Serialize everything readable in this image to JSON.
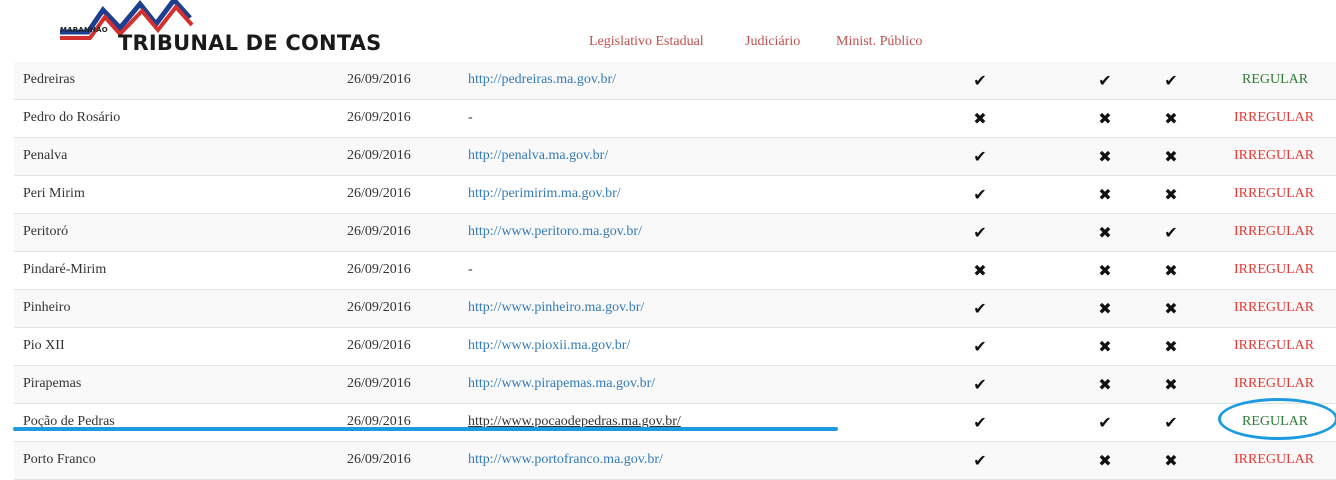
{
  "header": {
    "logo_small": "MARANHÃO",
    "logo_big": "TRIBUNAL DE CONTAS",
    "nav": [
      "Legislativo Estadual",
      "Judiciário",
      "Minist. Público"
    ]
  },
  "colors": {
    "link": "#337ab7",
    "nav": "#c0504d",
    "regular": "#2e7d32",
    "irregular": "#e53935",
    "annotation": "#1e9be0"
  },
  "icons": {
    "check": "check-icon",
    "cross": "cross-icon"
  },
  "rows": [
    {
      "name": "Pedreiras",
      "date": "26/09/2016",
      "url": "http://pedreiras.ma.gov.br/",
      "m1": "✔",
      "m2": "✔",
      "m3": "✔",
      "status": "REGULAR"
    },
    {
      "name": "Pedro do Rosário",
      "date": "26/09/2016",
      "url": "-",
      "m1": "✖",
      "m2": "✖",
      "m3": "✖",
      "status": "IRREGULAR"
    },
    {
      "name": "Penalva",
      "date": "26/09/2016",
      "url": "http://penalva.ma.gov.br/",
      "m1": "✔",
      "m2": "✖",
      "m3": "✖",
      "status": "IRREGULAR"
    },
    {
      "name": "Peri Mirim",
      "date": "26/09/2016",
      "url": "http://perimirim.ma.gov.br/",
      "m1": "✔",
      "m2": "✖",
      "m3": "✖",
      "status": "IRREGULAR"
    },
    {
      "name": "Peritoró",
      "date": "26/09/2016",
      "url": "http://www.peritoro.ma.gov.br/",
      "m1": "✔",
      "m2": "✖",
      "m3": "✔",
      "status": "IRREGULAR"
    },
    {
      "name": "Pindaré-Mirim",
      "date": "26/09/2016",
      "url": "-",
      "m1": "✖",
      "m2": "✖",
      "m3": "✖",
      "status": "IRREGULAR"
    },
    {
      "name": "Pinheiro",
      "date": "26/09/2016",
      "url": "http://www.pinheiro.ma.gov.br/",
      "m1": "✔",
      "m2": "✖",
      "m3": "✖",
      "status": "IRREGULAR"
    },
    {
      "name": "Pio XII",
      "date": "26/09/2016",
      "url": "http://www.pioxii.ma.gov.br/",
      "m1": "✔",
      "m2": "✖",
      "m3": "✖",
      "status": "IRREGULAR"
    },
    {
      "name": "Pirapemas",
      "date": "26/09/2016",
      "url": "http://www.pirapemas.ma.gov.br/",
      "m1": "✔",
      "m2": "✖",
      "m3": "✖",
      "status": "IRREGULAR"
    },
    {
      "name": "Poção de Pedras",
      "date": "26/09/2016",
      "url": "http://www.pocaodepedras.ma.gov.br/",
      "m1": "✔",
      "m2": "✔",
      "m3": "✔",
      "status": "REGULAR"
    },
    {
      "name": "Porto Franco",
      "date": "26/09/2016",
      "url": "http://www.portofranco.ma.gov.br/",
      "m1": "✔",
      "m2": "✖",
      "m3": "✖",
      "status": "IRREGULAR"
    }
  ]
}
